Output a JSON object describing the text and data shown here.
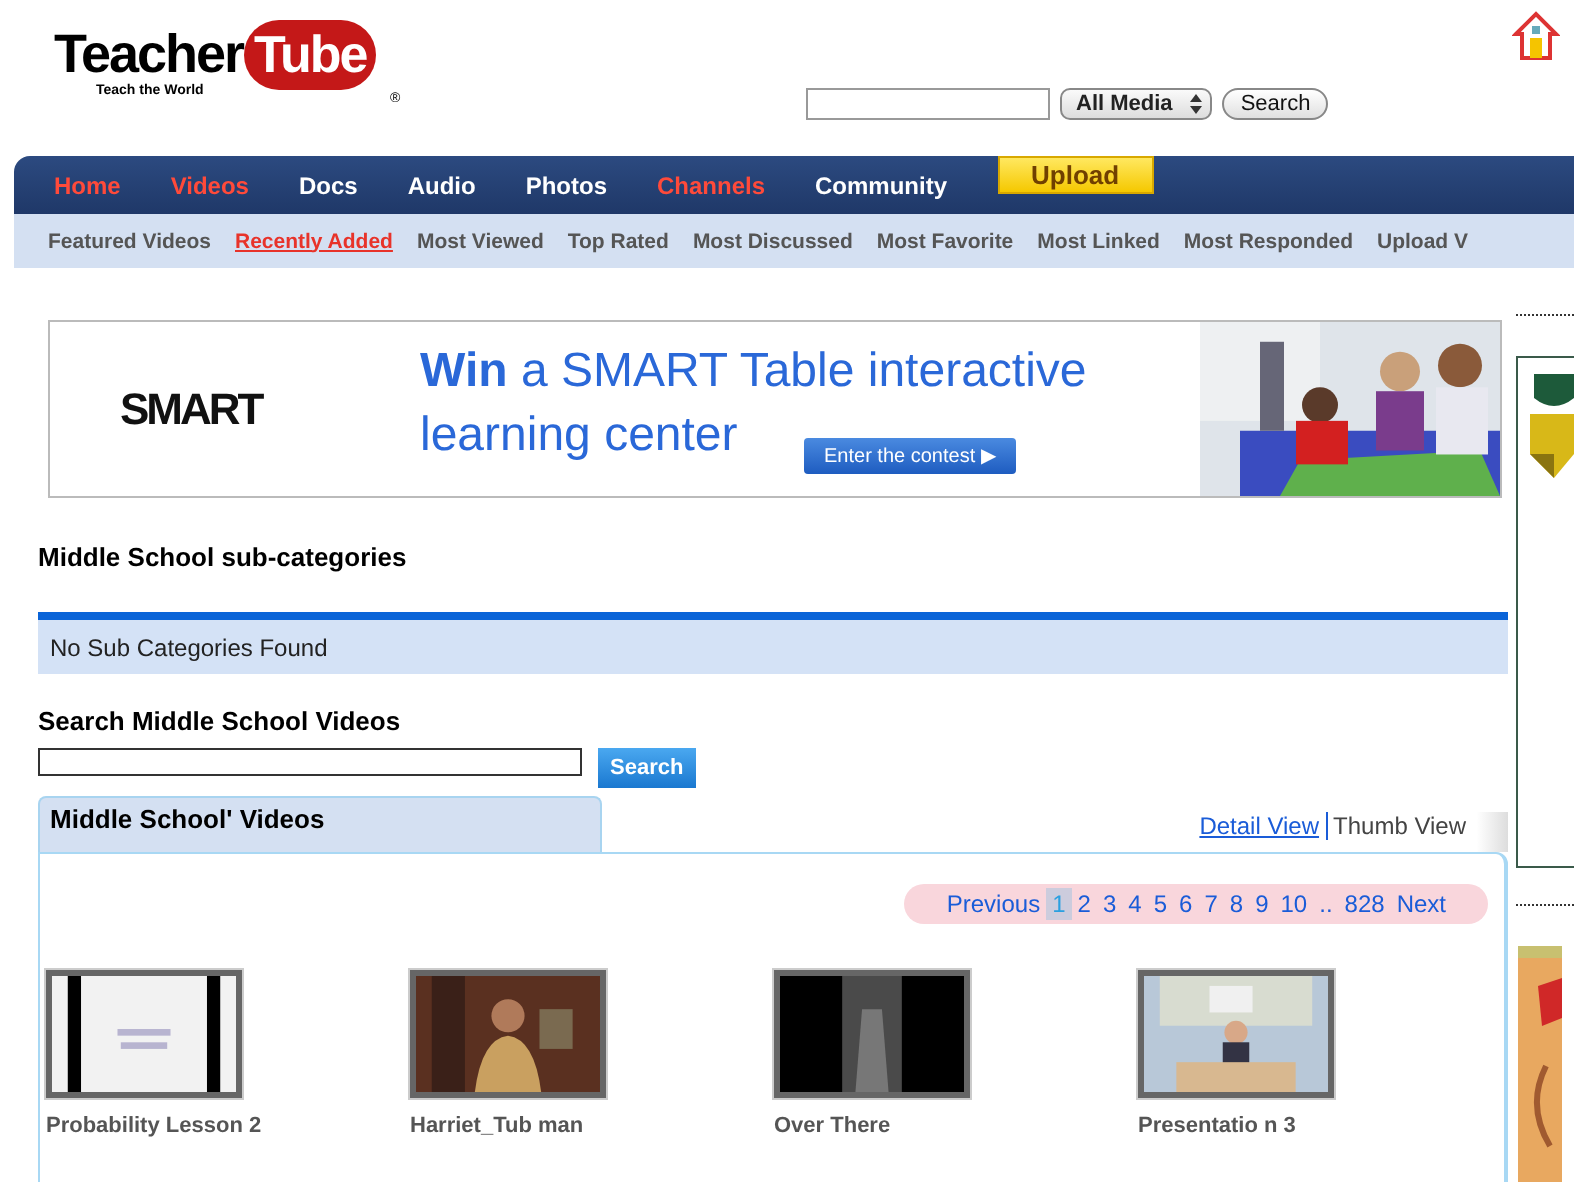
{
  "header": {
    "logo_text": "Teacher",
    "logo_apple_text": "Tube",
    "tagline": "Teach the World",
    "registered": "®",
    "search": {
      "media_select": "All Media",
      "button": "Search"
    }
  },
  "nav": [
    {
      "label": "Home",
      "color": "#ff4a3a",
      "kind": "link"
    },
    {
      "label": "Videos",
      "color": "#ff4a3a",
      "kind": "link"
    },
    {
      "label": "Docs",
      "color": "#ffffff",
      "kind": "link"
    },
    {
      "label": "Audio",
      "color": "#ffffff",
      "kind": "link"
    },
    {
      "label": "Photos",
      "color": "#ffffff",
      "kind": "link"
    },
    {
      "label": "Channels",
      "color": "#ff4a3a",
      "kind": "link"
    },
    {
      "label": "Community",
      "color": "#ffffff",
      "kind": "link"
    },
    {
      "label": "Upload",
      "kind": "button"
    }
  ],
  "subnav": [
    {
      "label": "Featured Videos",
      "selected": false
    },
    {
      "label": "Recently Added",
      "selected": true
    },
    {
      "label": "Most Viewed",
      "selected": false
    },
    {
      "label": "Top Rated",
      "selected": false
    },
    {
      "label": "Most Discussed",
      "selected": false
    },
    {
      "label": "Most Favorite",
      "selected": false
    },
    {
      "label": "Most Linked",
      "selected": false
    },
    {
      "label": "Most Responded",
      "selected": false
    },
    {
      "label": "Upload V",
      "selected": false
    }
  ],
  "banner": {
    "brand": "SMART",
    "headline": [
      "**Win** a SMART Table interactive",
      "learning center"
    ],
    "button": "Enter the contest ▶"
  },
  "subcategories": {
    "title": "Middle School sub-categories",
    "message": "No Sub Categories Found"
  },
  "video_search": {
    "title": "Search Middle School Videos",
    "button": "Search"
  },
  "videos": {
    "tab": "Middle School' Videos",
    "views": [
      {
        "label": "Detail View",
        "selected": false
      },
      {
        "label": "Thumb View",
        "selected": true
      }
    ],
    "pagination": [
      {
        "label": "Previous",
        "selected": false
      },
      {
        "label": "1",
        "selected": true
      },
      {
        "label": "2",
        "selected": false
      },
      {
        "label": "3",
        "selected": false
      },
      {
        "label": "4",
        "selected": false
      },
      {
        "label": "5",
        "selected": false
      },
      {
        "label": "6",
        "selected": false
      },
      {
        "label": "7",
        "selected": false
      },
      {
        "label": "8",
        "selected": false
      },
      {
        "label": "9",
        "selected": false
      },
      {
        "label": "10",
        "selected": false
      },
      {
        "label": "..",
        "selected": false
      },
      {
        "label": "828",
        "selected": false
      },
      {
        "label": "Next",
        "selected": false
      }
    ],
    "items": [
      {
        "title": "Probability Lesson 2",
        "kind": "slide"
      },
      {
        "title": "Harriet_Tub man",
        "kind": "room"
      },
      {
        "title": "Over There",
        "kind": "dark"
      },
      {
        "title": "Presentatio n 3",
        "kind": "class"
      }
    ]
  }
}
